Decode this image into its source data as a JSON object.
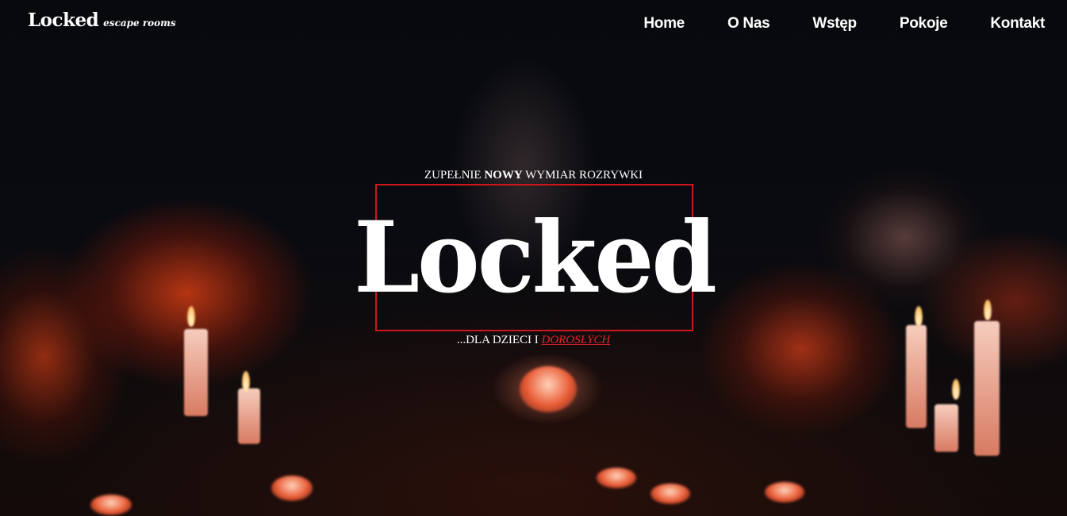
{
  "header": {
    "brand_main": "Locked",
    "brand_sub": "escape rooms",
    "nav": [
      {
        "label": "Home"
      },
      {
        "label": "O Nas"
      },
      {
        "label": "Wstęp"
      },
      {
        "label": "Pokoje"
      },
      {
        "label": "Kontakt"
      }
    ]
  },
  "hero": {
    "tagline_top_pre": "ZUPEŁNIE ",
    "tagline_top_bold": "NOWY",
    "tagline_top_post": " WYMIAR ROZRYWKI",
    "title": "Locked",
    "tagline_bottom_pre": "...DLA DZIECI I ",
    "tagline_bottom_link": "DOROSŁYCH",
    "accent_color": "#d0161d"
  }
}
